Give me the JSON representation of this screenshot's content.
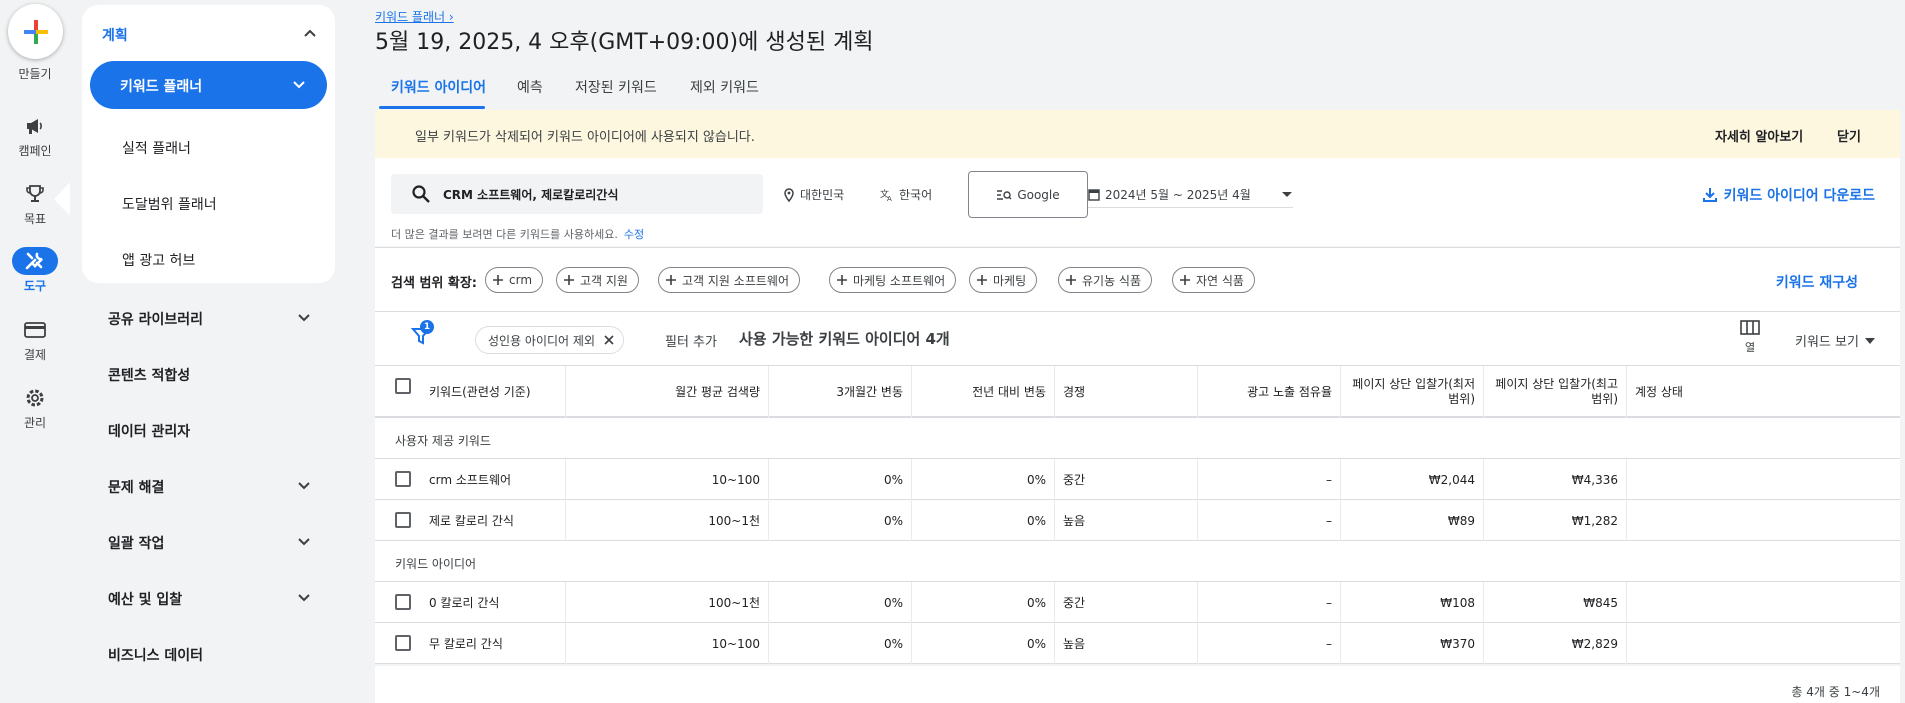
{
  "rail": {
    "create_label": "만들기",
    "items": [
      {
        "label": "캠페인",
        "icon": "megaphone-icon"
      },
      {
        "label": "목표",
        "icon": "trophy-icon"
      },
      {
        "label": "도구",
        "icon": "tools-icon"
      },
      {
        "label": "결제",
        "icon": "credit-card-icon"
      },
      {
        "label": "관리",
        "icon": "gear-icon"
      }
    ]
  },
  "nav": {
    "section_title": "계획",
    "active_item": "키워드 플래너",
    "sub_items": [
      "실적 플래너",
      "도달범위 플래너",
      "앱 광고 허브"
    ],
    "top_items": [
      "공유 라이브러리",
      "콘텐츠 적합성",
      "데이터 관리자",
      "문제 해결",
      "일괄 작업",
      "예산 및 입찰",
      "비즈니스 데이터"
    ]
  },
  "header": {
    "breadcrumb": "키워드 플래너",
    "title": "5월 19, 2025, 4 오후(GMT+09:00)에 생성된 계획"
  },
  "tabs": [
    "키워드 아이디어",
    "예측",
    "저장된 키워드",
    "제외 키워드"
  ],
  "banner": {
    "text": "일부 키워드가 삭제되어 키워드 아이디어에 사용되지 않습니다.",
    "learn_more": "자세히 알아보기",
    "close": "닫기"
  },
  "toolbar": {
    "search_value": "CRM 소프트웨어, 제로칼로리간식",
    "location": "대한민국",
    "language": "한국어",
    "network": "Google",
    "date_range": "2024년 5월 ~ 2025년 4월",
    "download": "키워드 아이디어 다운로드",
    "hint": "더 많은 결과를 보려면 다른 키워드를 사용하세요.",
    "hint_edit": "수정"
  },
  "expand": {
    "label": "검색 범위 확장:",
    "chips": [
      "crm",
      "고객 지원",
      "고객 지원 소프트웨어",
      "마케팅 소프트웨어",
      "마케팅",
      "유기농 식품",
      "자연 식품"
    ],
    "regroup": "키워드 재구성"
  },
  "filterbar": {
    "badge": "1",
    "chip": "성인용 아이디어 제외",
    "add_filter": "필터 추가",
    "available": "사용 가능한 키워드 아이디어 4개",
    "columns": "열",
    "view": "키워드 보기"
  },
  "table": {
    "headers": [
      "키워드(관련성 기준)",
      "월간 평균 검색량",
      "3개월간 변동",
      "전년 대비 변동",
      "경쟁",
      "광고 노출 점유율",
      "페이지 상단 입찰가(최저 범위)",
      "페이지 상단 입찰가(최고 범위)",
      "계정 상태"
    ],
    "group1": "사용자 제공 키워드",
    "group2": "키워드 아이디어",
    "rows": [
      [
        "crm 소프트웨어",
        "10~100",
        "0%",
        "0%",
        "중간",
        "–",
        "₩2,044",
        "₩4,336",
        ""
      ],
      [
        "제로 칼로리 간식",
        "100~1천",
        "0%",
        "0%",
        "높음",
        "–",
        "₩89",
        "₩1,282",
        ""
      ],
      [
        "0 칼로리 간식",
        "100~1천",
        "0%",
        "0%",
        "중간",
        "–",
        "₩108",
        "₩845",
        ""
      ],
      [
        "무 칼로리 간식",
        "10~100",
        "0%",
        "0%",
        "높음",
        "–",
        "₩370",
        "₩2,829",
        ""
      ]
    ],
    "footer": "총 4개 중 1~4개"
  }
}
